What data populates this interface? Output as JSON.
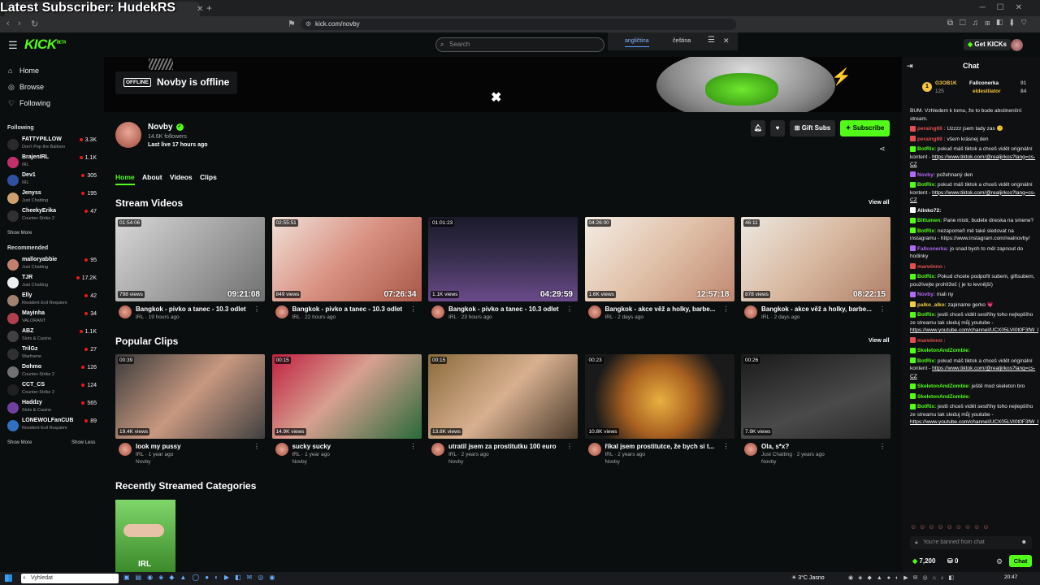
{
  "overlay": {
    "text": "Latest Subscriber: HudekRS"
  },
  "browser": {
    "url": "kick.com/novby"
  },
  "header": {
    "search_placeholder": "Search",
    "translate_langs": [
      "angličtina",
      "čeština"
    ],
    "get_kicks": "Get KICKs"
  },
  "sidebar": {
    "nav": [
      {
        "label": "Home",
        "icon": "home-icon"
      },
      {
        "label": "Browse",
        "icon": "compass-icon"
      },
      {
        "label": "Following",
        "icon": "heart-icon"
      }
    ],
    "following_title": "Following",
    "following": [
      {
        "name": "FATTYPILLOW",
        "category": "Don't Pop the Balloon",
        "viewers": "3.3K",
        "color": "#2a2a2a"
      },
      {
        "name": "BrajenIRL",
        "category": "IRL",
        "viewers": "1.1K",
        "color": "#c0306a"
      },
      {
        "name": "Dev1",
        "category": "IRL",
        "viewers": "305",
        "color": "#3050a0"
      },
      {
        "name": "Jenyss",
        "category": "Just Chatting",
        "viewers": "195",
        "color": "#d0a070"
      },
      {
        "name": "CheekyErika",
        "category": "Counter-Strike 2",
        "viewers": "47",
        "color": "#303030"
      }
    ],
    "show_more_1": "Show More",
    "recommended_title": "Recommended",
    "recommended": [
      {
        "name": "malloryabbie",
        "category": "Just Chatting",
        "viewers": "95",
        "color": "#c08070"
      },
      {
        "name": "TJR",
        "category": "Just Chatting",
        "viewers": "17.2K",
        "color": "#eeeeee"
      },
      {
        "name": "Elly",
        "category": "Resident Evil Requiem",
        "viewers": "42",
        "color": "#a08070"
      },
      {
        "name": "Mayinha",
        "category": "VALORANT",
        "viewers": "34",
        "color": "#b04050"
      },
      {
        "name": "ABZ",
        "category": "Slots & Casino",
        "viewers": "1.1K",
        "color": "#404040"
      },
      {
        "name": "TrilGz",
        "category": "Warframe",
        "viewers": "27",
        "color": "#303030"
      },
      {
        "name": "Dohmo",
        "category": "Counter-Strike 2",
        "viewers": "126",
        "color": "#707070"
      },
      {
        "name": "CCT_CS",
        "category": "Counter-Strike 2",
        "viewers": "124",
        "color": "#202020"
      },
      {
        "name": "Haddzy",
        "category": "Slots & Casino",
        "viewers": "565",
        "color": "#7040a0"
      },
      {
        "name": "LONEWOLFanCUB",
        "category": "Resident Evil Requiem",
        "viewers": "89",
        "color": "#3070c0"
      }
    ],
    "show_more_2": "Show More",
    "show_less": "Show Less"
  },
  "channel": {
    "offline_badge": "OFFLINE",
    "offline_title": "Novby is offline",
    "name": "Novby",
    "followers": "14.6K followers",
    "last_live": "Last live 17 hours ago",
    "gift_subs": "Gift Subs",
    "subscribe": "Subscribe",
    "tabs": [
      "Home",
      "About",
      "Videos",
      "Clips"
    ]
  },
  "stream_videos": {
    "title": "Stream Videos",
    "view_all": "View all",
    "items": [
      {
        "duration": "01:54:06",
        "views": "798 views",
        "overlay": "09:21:08",
        "title": "Bangkok - pivko a tanec - 10.3 odlet",
        "meta": "IRL · 19 hours ago",
        "bg": "linear-gradient(135deg,#d8d8d8,#9a9a9a 60%,#707070)"
      },
      {
        "duration": "02:55:51",
        "views": "849 views",
        "overlay": "07:26:34",
        "title": "Bangkok - pivko a tanec - 10.3 odlet",
        "meta": "IRL · 22 hours ago",
        "bg": "linear-gradient(135deg,#f0e0d8,#d89080 50%,#a85848)"
      },
      {
        "duration": "01:01:23",
        "views": "1.1K views",
        "overlay": "04:29:59",
        "title": "Bangkok - pivko a tanec - 10.3 odlet",
        "meta": "IRL · 23 hours ago",
        "bg": "linear-gradient(180deg,#1a1a2a,#3a3050 50%,#6a4a8a)"
      },
      {
        "duration": "04:26:00",
        "views": "1.6K views",
        "overlay": "12:57:18",
        "title": "Bangkok - akce věž a holky, barbe...",
        "meta": "IRL · 2 days ago",
        "bg": "linear-gradient(135deg,#f4ece4,#e0c0a8 50%,#c08870)"
      },
      {
        "duration": "46:11",
        "views": "878 views",
        "overlay": "08:22:15",
        "title": "Bangkok - akce věž a holky, barbe...",
        "meta": "IRL · 2 days ago",
        "bg": "linear-gradient(135deg,#ece8e0,#d8b8a0 50%,#b08068)"
      }
    ]
  },
  "popular_clips": {
    "title": "Popular Clips",
    "view_all": "View all",
    "items": [
      {
        "duration": "00:39",
        "views": "19.4K views",
        "title": "look my pussy",
        "meta": "IRL · 1 year ago",
        "author": "Novby",
        "bg": "linear-gradient(135deg,#3a3a3a,#c89880 50%,#404040)"
      },
      {
        "duration": "00:15",
        "views": "14.9K views",
        "title": "sucky sucky",
        "meta": "IRL · 1 year ago",
        "author": "Novby",
        "bg": "linear-gradient(135deg,#c02040,#d8a090 45%,#2a6a3a)"
      },
      {
        "duration": "00:15",
        "views": "13.8K views",
        "title": "utratil jsem za prostitutku 100 euro",
        "meta": "IRL · 2 years ago",
        "author": "Novby",
        "bg": "linear-gradient(135deg,#8a6a3a,#d8b090 50%,#4a3a2a)"
      },
      {
        "duration": "00:23",
        "views": "10.8K views",
        "title": "říkal jsem prostitutce, že bych si t...",
        "meta": "IRL · 2 years ago",
        "author": "Novby",
        "bg": "radial-gradient(circle at 50% 55%,#e8b040,#a86020 40%,#1a1a1a 75%)"
      },
      {
        "duration": "00:26",
        "views": "7.9K views",
        "title": "Ola, s*x?",
        "meta": "Just Chatting · 2 years ago",
        "author": "Novby",
        "bg": "linear-gradient(160deg,#1a1a1a,#4a4a4a 60%,#2a2a2a)"
      }
    ]
  },
  "categories": {
    "title": "Recently Streamed Categories",
    "items": [
      {
        "label": "IRL"
      }
    ]
  },
  "chat": {
    "title": "Chat",
    "leaderboard": {
      "top_name": "G3OB1K",
      "top_value": "125",
      "second_name": "Fallconerka",
      "second_value": "91",
      "third_name": "eldestilator",
      "third_value": "84",
      "rank": "1"
    },
    "messages": [
      {
        "user": "",
        "text": "BUM. Vzhledem k tomu, že to bude abstinenční stream.",
        "color": "#ccc"
      },
      {
        "user": "peraing69 :",
        "text": "Uzzzz jsem tady zas 🙂",
        "color": "#e05050"
      },
      {
        "user": "peraing69 :",
        "text": "všem krásnej den",
        "color": "#e05050"
      },
      {
        "user": "BotRix:",
        "text": "pokud máš tiktok a chceš vidět originální kontent - ",
        "link": "https://www.tiktok.com/@realjirkos?lang=cs-CZ",
        "color": "#53fc18"
      },
      {
        "user": "Novby:",
        "text": "požehnaný den",
        "color": "#b06af0"
      },
      {
        "user": "BotRix:",
        "text": "pokud máš tiktok a chceš vidět originální kontent - ",
        "link": "https://www.tiktok.com/@realjirkos?lang=cs-CZ",
        "color": "#53fc18"
      },
      {
        "user": "Alinko72:",
        "text": "",
        "color": "#ffffff"
      },
      {
        "user": "Bittumen:",
        "text": "Pane mistr, budete dneska na smene?",
        "color": "#53fc18"
      },
      {
        "user": "BotRix:",
        "text": "nezapomeň mě také sledovat na instagramu - https://www.instagram.com/realnovby/",
        "color": "#53fc18"
      },
      {
        "user": "Fallconerka:",
        "text": "jo snad bych to měl zapnout do hodinky",
        "color": "#b06af0"
      },
      {
        "user": "marwinno :",
        "text": "",
        "color": "#e05050"
      },
      {
        "user": "BotRix:",
        "text": "Pokud chcete podpořit subem, giftsubem, používejte prohlížeč ( je to levnější)",
        "color": "#53fc18"
      },
      {
        "user": "Novby:",
        "text": "mali ny",
        "color": "#b06af0"
      },
      {
        "user": "palko_alko:",
        "text": "zapiname gerko 💗",
        "color": "#f0d040"
      },
      {
        "user": "BotRix:",
        "text": "jestli chceš vidět sestřihy toho nejlepšího ze streamu tak sleduj můj youtube - ",
        "link": "https://www.youtube.com/channel/UCX05LVI0t0F3fW_bT3RSMw",
        "color": "#53fc18"
      },
      {
        "user": "marwinno :",
        "text": "",
        "color": "#e05050"
      },
      {
        "user": "SkeletonAndZombie:",
        "text": "",
        "color": "#53fc18"
      },
      {
        "user": "BotRix:",
        "text": "pokud máš tiktok a chceš vidět originální kontent - ",
        "link": "https://www.tiktok.com/@realjirkos?lang=cs-CZ",
        "color": "#53fc18"
      },
      {
        "user": "SkeletonAndZombie:",
        "text": "ještě mod skeleton bro",
        "color": "#53fc18"
      },
      {
        "user": "SkeletonAndZombie:",
        "text": "",
        "color": "#53fc18"
      },
      {
        "user": "BotRix:",
        "text": "jestli chceš vidět sestřihy toho nejlepšího ze streamu tak sleduj můj youtube - ",
        "link": "https://www.youtube.com/channel/UCX05LVI0t0F3fW_bT3RSMw",
        "color": "#53fc18"
      }
    ],
    "banned_placeholder": "You're banned from chat",
    "kicks_balance": "7,200",
    "drops": "0",
    "chat_button": "Chat"
  },
  "taskbar": {
    "search_placeholder": "Vyhledat",
    "weather": "3°C Jasno",
    "time": "20:47"
  }
}
